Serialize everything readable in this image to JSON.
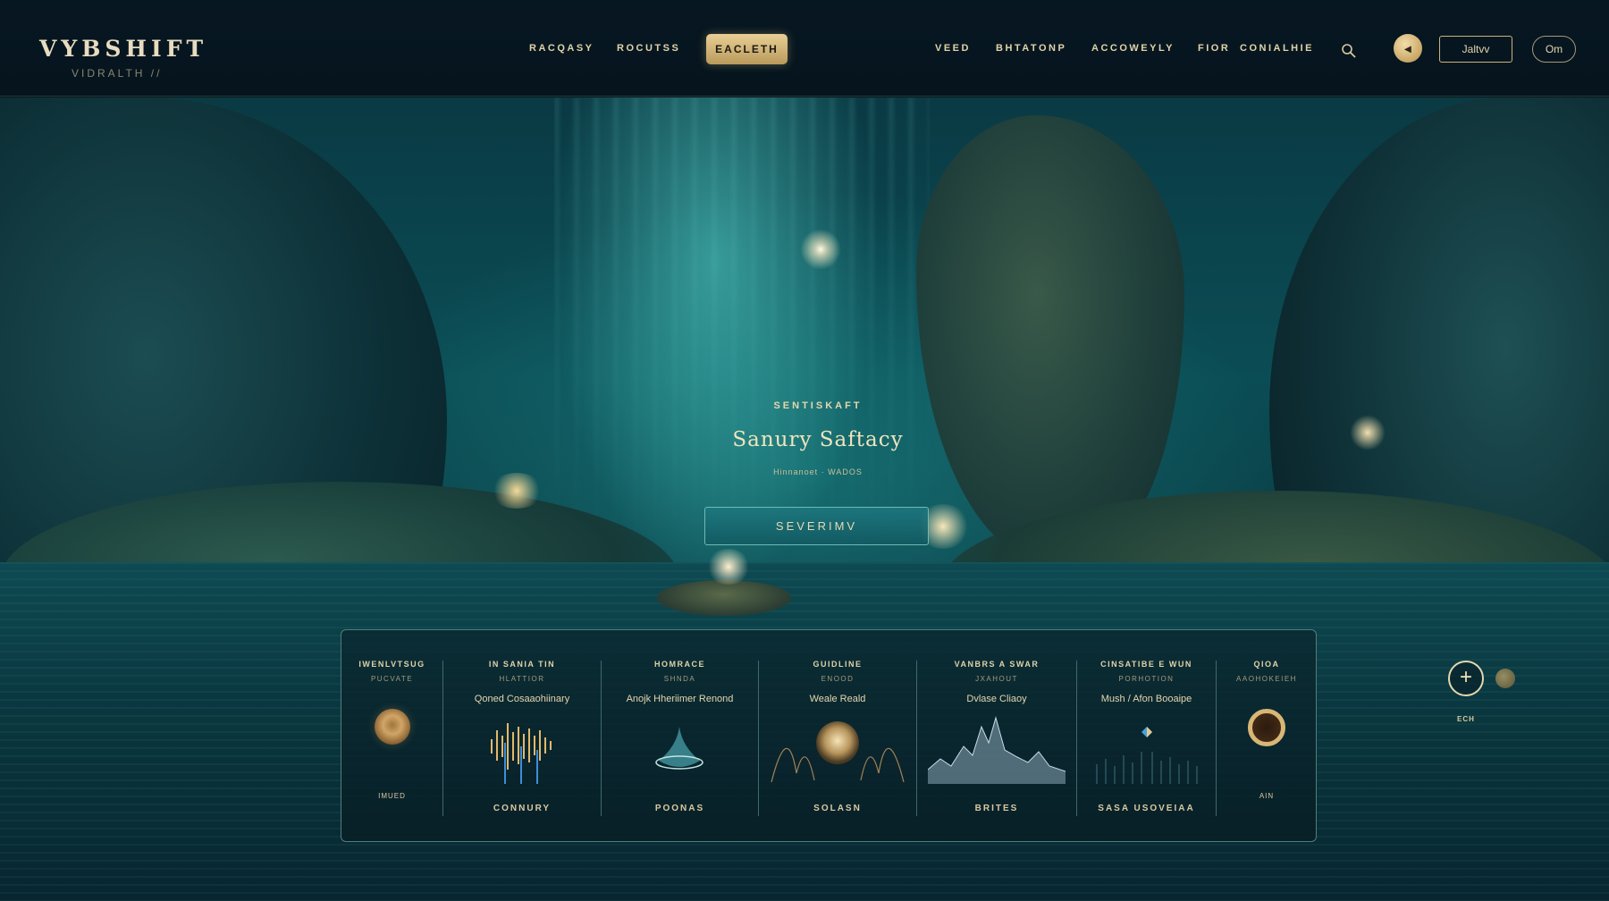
{
  "brand": {
    "name": "VYBSHIFT",
    "tagline": "VIDRALTH //"
  },
  "nav": {
    "items": [
      "RACQASY",
      "ROCUTSS",
      "VEED",
      "BHTATONP",
      "ACCOWEYLY",
      "FIOR",
      "CONIALHIE"
    ],
    "active": "EACLETH"
  },
  "header_actions": {
    "search_icon": "search-icon",
    "circle_label": "◂",
    "outline_label": "Jaltvv",
    "pill_label": "Om"
  },
  "hero": {
    "eyebrow": "SENTISKAFT",
    "title": "Sanury Saftacy",
    "subtitle": "Hinnanoet · WADOS",
    "cta_label": "SEVERIMV"
  },
  "panel": {
    "columns": [
      {
        "title": "IWENLVTSUG",
        "sub": "PUCVATE",
        "desc": "",
        "foot": "IMUED",
        "foot_style": "small",
        "visual": "disc"
      },
      {
        "title": "IN SANIA TIN",
        "sub": "HLATTIOR",
        "desc": "Qoned Cosaaohiinary",
        "foot": "CONNURY",
        "visual": "waveform"
      },
      {
        "title": "HOMRACE",
        "sub": "SHNDA",
        "desc": "Anojk Hheriimer Renond",
        "foot": "POONAS",
        "visual": "drop"
      },
      {
        "title": "GUIDLINE",
        "sub": "ENOOD",
        "desc": "Weale Reald",
        "foot": "SOLASN",
        "visual": "orb"
      },
      {
        "title": "VANBRS A SWAR",
        "sub": "JXAHOUT",
        "desc": "Dvlase Cliaoy",
        "foot": "BRITES",
        "visual": "peaks"
      },
      {
        "title": "CINSATIBE E WUN",
        "sub": "PORHOTION",
        "desc": "Mush / Afon Booaipe",
        "foot": "SASA USOVEIAA",
        "visual": "spike"
      },
      {
        "title": "QIOA",
        "sub": "AAOHOKEIEH",
        "desc": "",
        "foot": "AIN",
        "foot_style": "small",
        "visual": "ring"
      }
    ]
  },
  "side": {
    "fab_symbol": "+",
    "fab_label": "ECH"
  },
  "colors": {
    "gold": "#d8b676",
    "teal": "#0b4d55",
    "panel_border": "#4f7f7c"
  }
}
